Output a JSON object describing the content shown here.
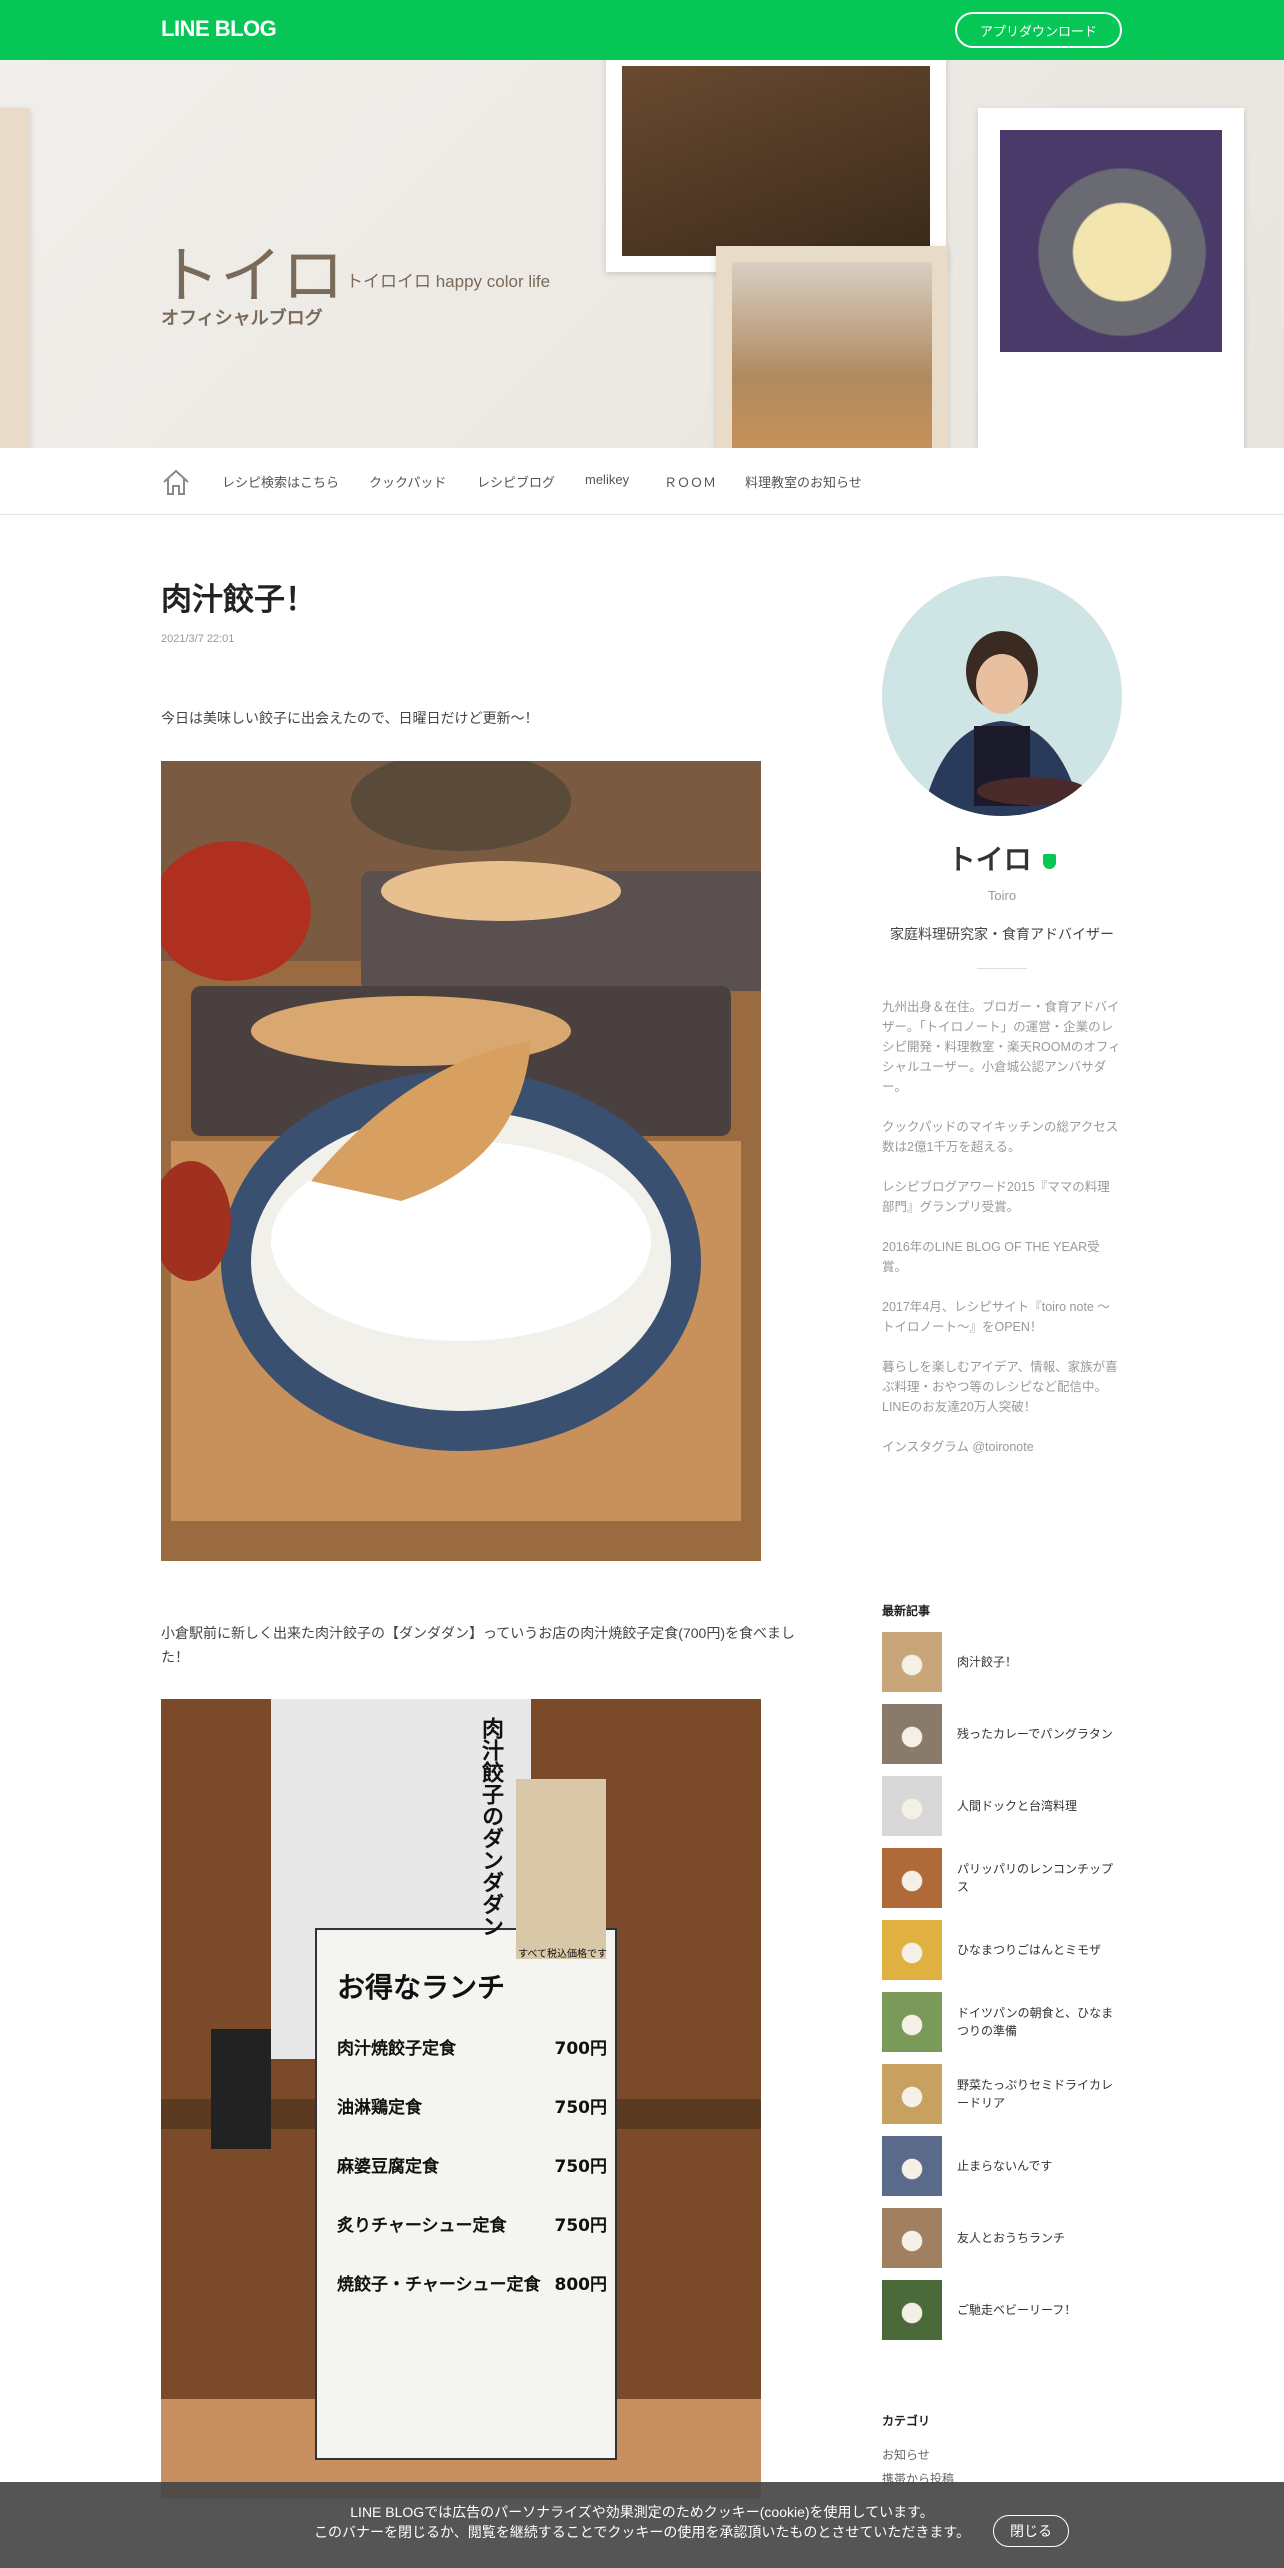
{
  "topbar": {
    "logo": "LINE BLOG",
    "app_download": "アプリダウンロード"
  },
  "header": {
    "title": "トイロ",
    "subtitle": "トイロイロ happy color life",
    "tagline": "オフィシャルブログ"
  },
  "nav": {
    "home_icon": "home-icon",
    "items": [
      "レシピ検索はこちら",
      "クックパッド",
      "レシピブログ",
      "melikey",
      "ＲＯＯＭ",
      "料理教室のお知らせ"
    ]
  },
  "post": {
    "title": "肉汁餃子！",
    "date": "2021/3/7 22:01",
    "p1": "今日は美味しい餃子に出会えたので、日曜日だけど更新〜！",
    "p2": "小倉駅前に新しく出来た肉汁餃子の【ダンダダン】っていうお店の肉汁焼餃子定食(700円)を食べました！"
  },
  "menu_board": {
    "title": "お得なランチ",
    "top": "すべて税込価格です",
    "brand": "肉汁餃子のダンダダン",
    "items": [
      {
        "name": "肉汁焼餃子定食",
        "price": "700円"
      },
      {
        "name": "油淋鶏定食",
        "price": "750円"
      },
      {
        "name": "麻婆豆腐定食",
        "price": "750円"
      },
      {
        "name": "炙りチャーシュー定食",
        "price": "750円"
      },
      {
        "name": "焼餃子・チャーシュー定食",
        "price": "800円"
      }
    ]
  },
  "profile": {
    "name": "トイロ",
    "romaji": "Toiro",
    "role": "家庭料理研究家・食育アドバイザー",
    "bio": [
      "九州出身＆在住。ブロガー・食育アドバイザー。「トイロノート」の運営・企業のレシピ開発・料理教室・楽天ROOMのオフィシャルユーザー。小倉城公認アンバサダー。",
      "クックパッドのマイキッチンの総アクセス数は2億1千万を超える。",
      "レシピブログアワード2015『ママの料理部門』グランプリ受賞。",
      "2016年のLINE BLOG OF THE YEAR受賞。",
      "2017年4月、レシピサイト『toiro note 〜トイロノート〜』をOPEN！",
      "暮らしを楽しむアイデア、情報、家族が喜ぶ料理・おやつ等のレシピなど配信中。LINEのお友達20万人突破！",
      "インスタグラム @toironote"
    ]
  },
  "recent": {
    "heading": "最新記事",
    "items": [
      {
        "title": "肉汁餃子！",
        "color": "#c9a57a"
      },
      {
        "title": "残ったカレーでパングラタン",
        "color": "#8a7a6a"
      },
      {
        "title": "人間ドックと台湾料理",
        "color": "#d8d8d8"
      },
      {
        "title": "パリッパリのレンコンチップス",
        "color": "#b06a3a"
      },
      {
        "title": "ひなまつりごはんとミモザ",
        "color": "#e0b040"
      },
      {
        "title": "ドイツパンの朝食と、ひなまつりの準備",
        "color": "#7a9a5a"
      },
      {
        "title": "野菜たっぷりセミドライカレードリア",
        "color": "#c8a060"
      },
      {
        "title": "止まらないんです",
        "color": "#5a6a8a"
      },
      {
        "title": "友人とおうちランチ",
        "color": "#a08060"
      },
      {
        "title": "ご馳走ベビーリーフ！",
        "color": "#4a6a3a"
      }
    ]
  },
  "categories": {
    "heading": "カテゴリ",
    "items": [
      "お知らせ",
      "携帯から投稿"
    ]
  },
  "cookie": {
    "line1": "LINE BLOGでは広告のパーソナライズや効果測定のためクッキー(cookie)を使用しています。",
    "line2": "このバナーを閉じるか、閲覧を継続することでクッキーの使用を承認頂いたものとさせていただきます。",
    "close": "閉じる"
  }
}
